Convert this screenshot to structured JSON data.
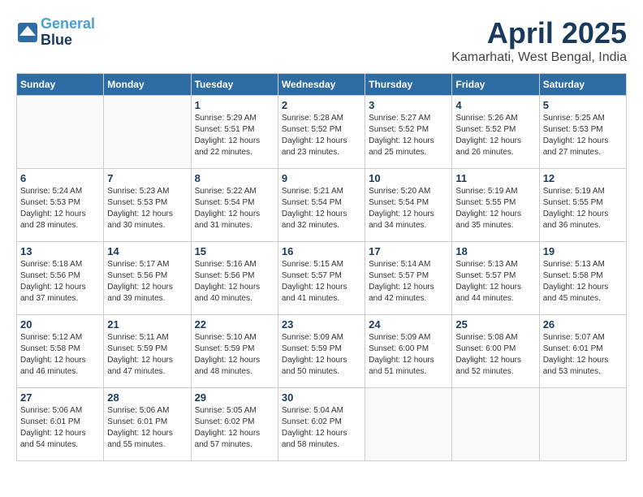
{
  "header": {
    "logo_line1": "General",
    "logo_line2": "Blue",
    "month_title": "April 2025",
    "subtitle": "Kamarhati, West Bengal, India"
  },
  "weekdays": [
    "Sunday",
    "Monday",
    "Tuesday",
    "Wednesday",
    "Thursday",
    "Friday",
    "Saturday"
  ],
  "weeks": [
    [
      {
        "day": "",
        "sunrise": "",
        "sunset": "",
        "daylight": ""
      },
      {
        "day": "",
        "sunrise": "",
        "sunset": "",
        "daylight": ""
      },
      {
        "day": "1",
        "sunrise": "Sunrise: 5:29 AM",
        "sunset": "Sunset: 5:51 PM",
        "daylight": "Daylight: 12 hours and 22 minutes."
      },
      {
        "day": "2",
        "sunrise": "Sunrise: 5:28 AM",
        "sunset": "Sunset: 5:52 PM",
        "daylight": "Daylight: 12 hours and 23 minutes."
      },
      {
        "day": "3",
        "sunrise": "Sunrise: 5:27 AM",
        "sunset": "Sunset: 5:52 PM",
        "daylight": "Daylight: 12 hours and 25 minutes."
      },
      {
        "day": "4",
        "sunrise": "Sunrise: 5:26 AM",
        "sunset": "Sunset: 5:52 PM",
        "daylight": "Daylight: 12 hours and 26 minutes."
      },
      {
        "day": "5",
        "sunrise": "Sunrise: 5:25 AM",
        "sunset": "Sunset: 5:53 PM",
        "daylight": "Daylight: 12 hours and 27 minutes."
      }
    ],
    [
      {
        "day": "6",
        "sunrise": "Sunrise: 5:24 AM",
        "sunset": "Sunset: 5:53 PM",
        "daylight": "Daylight: 12 hours and 28 minutes."
      },
      {
        "day": "7",
        "sunrise": "Sunrise: 5:23 AM",
        "sunset": "Sunset: 5:53 PM",
        "daylight": "Daylight: 12 hours and 30 minutes."
      },
      {
        "day": "8",
        "sunrise": "Sunrise: 5:22 AM",
        "sunset": "Sunset: 5:54 PM",
        "daylight": "Daylight: 12 hours and 31 minutes."
      },
      {
        "day": "9",
        "sunrise": "Sunrise: 5:21 AM",
        "sunset": "Sunset: 5:54 PM",
        "daylight": "Daylight: 12 hours and 32 minutes."
      },
      {
        "day": "10",
        "sunrise": "Sunrise: 5:20 AM",
        "sunset": "Sunset: 5:54 PM",
        "daylight": "Daylight: 12 hours and 34 minutes."
      },
      {
        "day": "11",
        "sunrise": "Sunrise: 5:19 AM",
        "sunset": "Sunset: 5:55 PM",
        "daylight": "Daylight: 12 hours and 35 minutes."
      },
      {
        "day": "12",
        "sunrise": "Sunrise: 5:19 AM",
        "sunset": "Sunset: 5:55 PM",
        "daylight": "Daylight: 12 hours and 36 minutes."
      }
    ],
    [
      {
        "day": "13",
        "sunrise": "Sunrise: 5:18 AM",
        "sunset": "Sunset: 5:56 PM",
        "daylight": "Daylight: 12 hours and 37 minutes."
      },
      {
        "day": "14",
        "sunrise": "Sunrise: 5:17 AM",
        "sunset": "Sunset: 5:56 PM",
        "daylight": "Daylight: 12 hours and 39 minutes."
      },
      {
        "day": "15",
        "sunrise": "Sunrise: 5:16 AM",
        "sunset": "Sunset: 5:56 PM",
        "daylight": "Daylight: 12 hours and 40 minutes."
      },
      {
        "day": "16",
        "sunrise": "Sunrise: 5:15 AM",
        "sunset": "Sunset: 5:57 PM",
        "daylight": "Daylight: 12 hours and 41 minutes."
      },
      {
        "day": "17",
        "sunrise": "Sunrise: 5:14 AM",
        "sunset": "Sunset: 5:57 PM",
        "daylight": "Daylight: 12 hours and 42 minutes."
      },
      {
        "day": "18",
        "sunrise": "Sunrise: 5:13 AM",
        "sunset": "Sunset: 5:57 PM",
        "daylight": "Daylight: 12 hours and 44 minutes."
      },
      {
        "day": "19",
        "sunrise": "Sunrise: 5:13 AM",
        "sunset": "Sunset: 5:58 PM",
        "daylight": "Daylight: 12 hours and 45 minutes."
      }
    ],
    [
      {
        "day": "20",
        "sunrise": "Sunrise: 5:12 AM",
        "sunset": "Sunset: 5:58 PM",
        "daylight": "Daylight: 12 hours and 46 minutes."
      },
      {
        "day": "21",
        "sunrise": "Sunrise: 5:11 AM",
        "sunset": "Sunset: 5:59 PM",
        "daylight": "Daylight: 12 hours and 47 minutes."
      },
      {
        "day": "22",
        "sunrise": "Sunrise: 5:10 AM",
        "sunset": "Sunset: 5:59 PM",
        "daylight": "Daylight: 12 hours and 48 minutes."
      },
      {
        "day": "23",
        "sunrise": "Sunrise: 5:09 AM",
        "sunset": "Sunset: 5:59 PM",
        "daylight": "Daylight: 12 hours and 50 minutes."
      },
      {
        "day": "24",
        "sunrise": "Sunrise: 5:09 AM",
        "sunset": "Sunset: 6:00 PM",
        "daylight": "Daylight: 12 hours and 51 minutes."
      },
      {
        "day": "25",
        "sunrise": "Sunrise: 5:08 AM",
        "sunset": "Sunset: 6:00 PM",
        "daylight": "Daylight: 12 hours and 52 minutes."
      },
      {
        "day": "26",
        "sunrise": "Sunrise: 5:07 AM",
        "sunset": "Sunset: 6:01 PM",
        "daylight": "Daylight: 12 hours and 53 minutes."
      }
    ],
    [
      {
        "day": "27",
        "sunrise": "Sunrise: 5:06 AM",
        "sunset": "Sunset: 6:01 PM",
        "daylight": "Daylight: 12 hours and 54 minutes."
      },
      {
        "day": "28",
        "sunrise": "Sunrise: 5:06 AM",
        "sunset": "Sunset: 6:01 PM",
        "daylight": "Daylight: 12 hours and 55 minutes."
      },
      {
        "day": "29",
        "sunrise": "Sunrise: 5:05 AM",
        "sunset": "Sunset: 6:02 PM",
        "daylight": "Daylight: 12 hours and 57 minutes."
      },
      {
        "day": "30",
        "sunrise": "Sunrise: 5:04 AM",
        "sunset": "Sunset: 6:02 PM",
        "daylight": "Daylight: 12 hours and 58 minutes."
      },
      {
        "day": "",
        "sunrise": "",
        "sunset": "",
        "daylight": ""
      },
      {
        "day": "",
        "sunrise": "",
        "sunset": "",
        "daylight": ""
      },
      {
        "day": "",
        "sunrise": "",
        "sunset": "",
        "daylight": ""
      }
    ]
  ]
}
